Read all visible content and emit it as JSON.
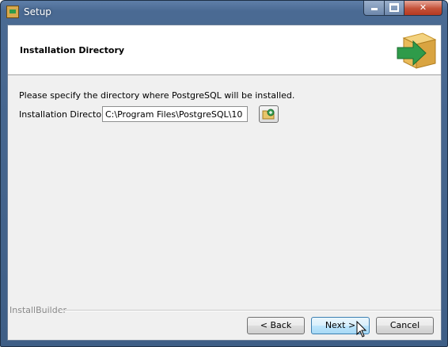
{
  "window": {
    "title": "Setup",
    "icon": "installer-box-icon"
  },
  "title_controls": {
    "minimize": "minimize-icon",
    "maximize": "maximize-icon",
    "close": "close-icon"
  },
  "header": {
    "title": "Installation Directory",
    "logo": "box-arrow-logo"
  },
  "content": {
    "description": "Please specify the directory where PostgreSQL will be installed.",
    "directory_label": "Installation Directory",
    "directory_value": "C:\\Program Files\\PostgreSQL\\10",
    "browse_icon": "folder-browse-icon"
  },
  "footer": {
    "brand": "InstallBuilder",
    "back_label": "< Back",
    "next_label": "Next >",
    "cancel_label": "Cancel"
  },
  "colors": {
    "titlebar": "#4a6a93",
    "close_button": "#c45138",
    "default_button_border": "#3c7fb1",
    "arrow_green": "#2f9b4a"
  }
}
